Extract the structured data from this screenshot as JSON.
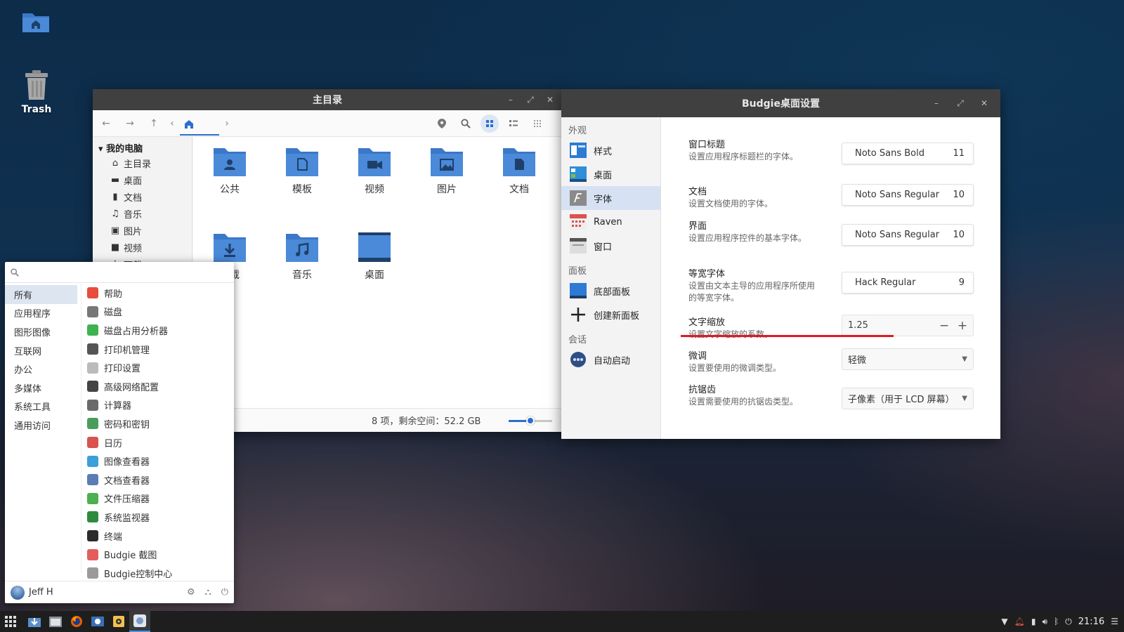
{
  "desktop": {
    "trash_label": "Trash"
  },
  "file_manager": {
    "title": "主目录",
    "sidebar": {
      "header": "我的电脑",
      "items": [
        {
          "label": "主目录",
          "icon": "home-icon"
        },
        {
          "label": "桌面",
          "icon": "desktop-icon"
        },
        {
          "label": "文档",
          "icon": "document-icon"
        },
        {
          "label": "音乐",
          "icon": "music-icon"
        },
        {
          "label": "图片",
          "icon": "picture-icon"
        },
        {
          "label": "视频",
          "icon": "video-icon"
        },
        {
          "label": "下载",
          "icon": "download-icon"
        }
      ]
    },
    "folders": [
      {
        "name": "公共",
        "icon": "public-folder-icon"
      },
      {
        "name": "模板",
        "icon": "templates-folder-icon"
      },
      {
        "name": "视频",
        "icon": "videos-folder-icon"
      },
      {
        "name": "图片",
        "icon": "pictures-folder-icon"
      },
      {
        "name": "文档",
        "icon": "documents-folder-icon"
      },
      {
        "name": "下载",
        "icon": "downloads-folder-icon"
      },
      {
        "name": "音乐",
        "icon": "music-folder-icon"
      },
      {
        "name": "桌面",
        "icon": "desktop-folder-icon"
      }
    ],
    "status": "8 项，剩余空间：52.2 GB",
    "zoom_fraction": 0.5
  },
  "settings": {
    "title": "Budgie桌面设置",
    "sections": {
      "appearance": "外观",
      "panel": "面板",
      "session": "会话"
    },
    "nav": {
      "style": "样式",
      "desktop": "桌面",
      "fonts": "字体",
      "raven": "Raven",
      "windows": "窗口",
      "bottom_panel": "底部面板",
      "new_panel": "创建新面板",
      "autostart": "自动启动"
    },
    "rows": {
      "window_title": {
        "label": "窗口标题",
        "desc": "设置应用程序标题栏的字体。",
        "font": "Noto Sans Bold",
        "size": "11"
      },
      "documents": {
        "label": "文档",
        "desc": "设置文档使用的字体。",
        "font": "Noto Sans Regular",
        "size": "10"
      },
      "interface": {
        "label": "界面",
        "desc": "设置应用程序控件的基本字体。",
        "font": "Noto Sans Regular",
        "size": "10"
      },
      "monospace": {
        "label": "等宽字体",
        "desc": "设置由文本主导的应用程序所使用的等宽字体。",
        "font": "Hack Regular",
        "size": "9"
      },
      "scaling": {
        "label": "文字缩放",
        "desc": "设置文字缩放的系数。",
        "value": "1.25"
      },
      "hinting": {
        "label": "微调",
        "desc": "设置要使用的微调类型。",
        "value": "轻微"
      },
      "antialias": {
        "label": "抗锯齿",
        "desc": "设置需要使用的抗锯齿类型。",
        "value": "子像素（用于 LCD 屏幕）"
      }
    }
  },
  "menu": {
    "search_placeholder": "",
    "categories": [
      "所有",
      "应用程序",
      "图形图像",
      "互联网",
      "办公",
      "多媒体",
      "系统工具",
      "通用访问"
    ],
    "apps": [
      {
        "label": "帮助",
        "color": "#e74c3c"
      },
      {
        "label": "磁盘",
        "color": "#777777"
      },
      {
        "label": "磁盘占用分析器",
        "color": "#3fb24f"
      },
      {
        "label": "打印机管理",
        "color": "#555555"
      },
      {
        "label": "打印设置",
        "color": "#bbbbbb"
      },
      {
        "label": "高级网络配置",
        "color": "#444444"
      },
      {
        "label": "计算器",
        "color": "#6b6b6b"
      },
      {
        "label": "密码和密钥",
        "color": "#4a9e5c"
      },
      {
        "label": "日历",
        "color": "#d9534f"
      },
      {
        "label": "图像查看器",
        "color": "#3aa0d8"
      },
      {
        "label": "文档查看器",
        "color": "#5a7db5"
      },
      {
        "label": "文件压缩器",
        "color": "#4caf50"
      },
      {
        "label": "系统监视器",
        "color": "#2e8b3e"
      },
      {
        "label": "终端",
        "color": "#2b2b2b"
      },
      {
        "label": "Budgie 截图",
        "color": "#e35d5d"
      },
      {
        "label": "Budgie控制中心",
        "color": "#9a9a9a"
      }
    ],
    "user": "Jeff H"
  },
  "taskbar": {
    "clock": "21:16"
  },
  "colors": {
    "accent": "#2a6fd0",
    "folder": "#4a86d4",
    "titlebar": "#404040",
    "highlight_line": "#e0191f"
  }
}
